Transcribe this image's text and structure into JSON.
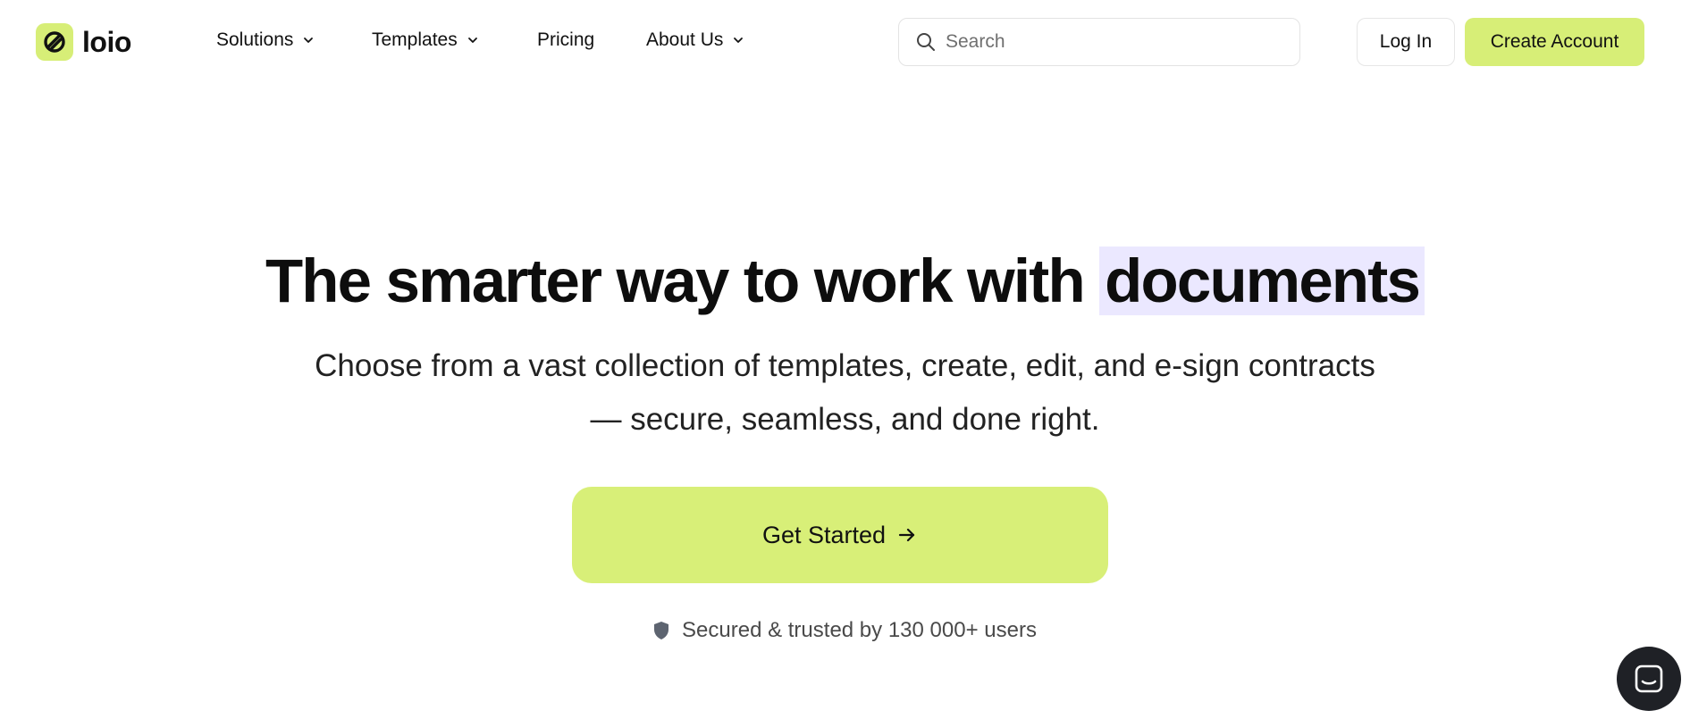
{
  "brand": {
    "name": "loio",
    "accent_color": "#d7ee77"
  },
  "nav": {
    "items": [
      {
        "label": "Solutions",
        "has_dropdown": true
      },
      {
        "label": "Templates",
        "has_dropdown": true
      },
      {
        "label": "Pricing",
        "has_dropdown": false
      },
      {
        "label": "About Us",
        "has_dropdown": true
      }
    ],
    "search": {
      "placeholder": "Search",
      "value": ""
    },
    "login_label": "Log In",
    "create_account_label": "Create Account"
  },
  "hero": {
    "headline_main": "The smarter way to work with",
    "headline_highlight": "documents",
    "highlight_color": "#ebe8ff",
    "subheadline_line1": "Choose from a vast collection of templates, create, edit, and e-sign contracts",
    "subheadline_line2": "— secure, seamless, and done right.",
    "cta_label": "Get Started",
    "trust_text": "Secured & trusted by 130 000+ users"
  },
  "icons": {
    "logo": "loio-logo-icon",
    "dropdown": "chevron-down-icon",
    "search": "search-icon",
    "cta": "arrow-right-icon",
    "trust": "shield-icon",
    "chat": "chat-icon"
  }
}
